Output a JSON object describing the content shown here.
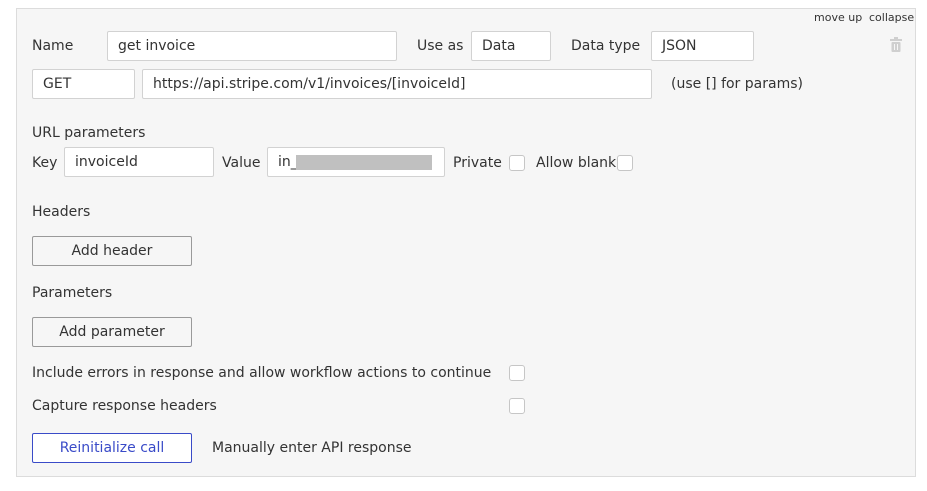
{
  "header_links": {
    "move_up": "move up",
    "collapse": "collapse"
  },
  "call": {
    "name_label": "Name",
    "name_value": "get invoice",
    "use_as_label": "Use as",
    "use_as_value": "Data",
    "data_type_label": "Data type",
    "data_type_value": "JSON",
    "method": "GET",
    "url": "https://api.stripe.com/v1/invoices/[invoiceId]",
    "url_hint": "(use [] for params)"
  },
  "url_parameters": {
    "section_label": "URL parameters",
    "key_label": "Key",
    "key_value": "invoiceId",
    "value_label": "Value",
    "value_value": "in_",
    "private_label": "Private",
    "allow_blank_label": "Allow blank"
  },
  "headers": {
    "section_label": "Headers",
    "add_button": "Add header"
  },
  "parameters": {
    "section_label": "Parameters",
    "add_button": "Add parameter"
  },
  "options": {
    "include_errors_label": "Include errors in response and allow workflow actions to continue",
    "capture_headers_label": "Capture response headers"
  },
  "footer": {
    "reinitialize_button": "Reinitialize call",
    "manual_entry_link": "Manually enter API response"
  },
  "icons": {
    "delete": "trash-icon"
  },
  "colors": {
    "accent": "#3a4bc8",
    "panel_bg": "#f6f6f6",
    "border": "#dcdcdc"
  }
}
